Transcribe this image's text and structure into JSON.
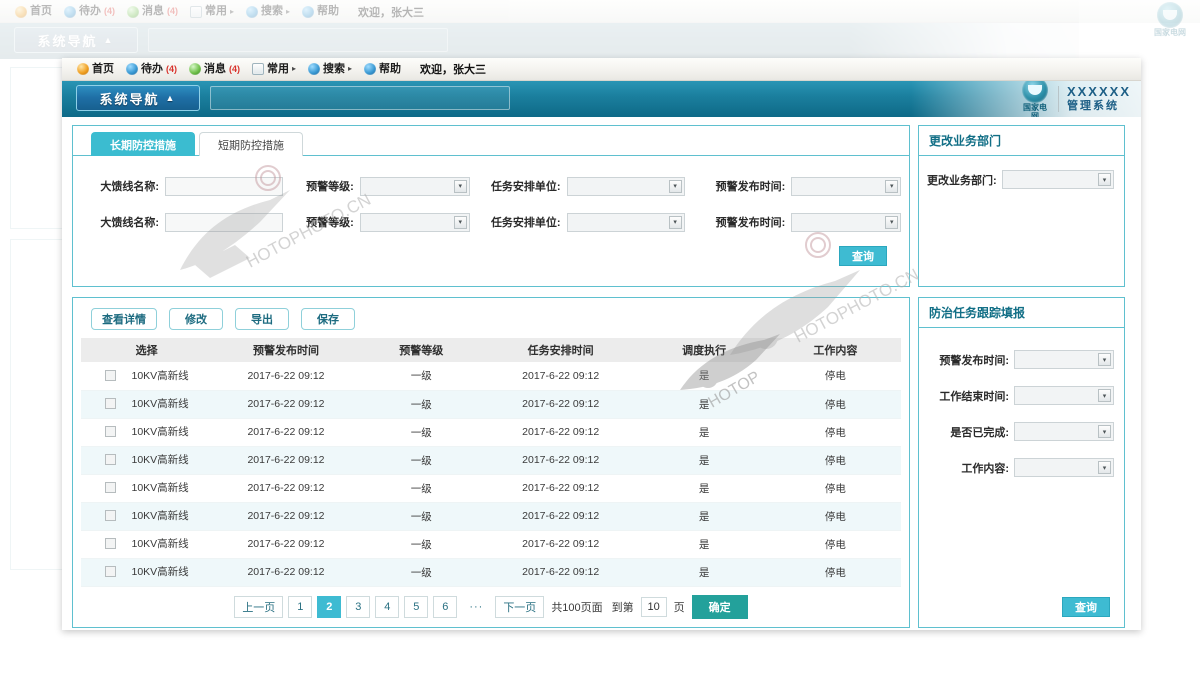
{
  "topbar": {
    "items": [
      {
        "label": "首页",
        "icon": "home-icon",
        "badge": "",
        "caret": false
      },
      {
        "label": "待办",
        "icon": "todo-icon",
        "badge": "(4)",
        "caret": false
      },
      {
        "label": "消息",
        "icon": "message-icon",
        "badge": "(4)",
        "caret": false
      },
      {
        "label": "常用",
        "icon": "common-icon",
        "badge": "",
        "caret": true
      },
      {
        "label": "搜索",
        "icon": "search-icon",
        "badge": "",
        "caret": true
      },
      {
        "label": "帮助",
        "icon": "help-icon",
        "badge": "",
        "caret": false
      }
    ],
    "welcome": "欢迎，张大三"
  },
  "nav": {
    "button_label": "系统导航",
    "button_caret": "▲"
  },
  "brand": {
    "logo_text": "国家电网",
    "title": "XXXXXX",
    "subtitle": "管理系统"
  },
  "search_panel": {
    "tabs": [
      {
        "label": "长期防控措施",
        "active": true
      },
      {
        "label": "短期防控措施",
        "active": false
      }
    ],
    "rows": [
      {
        "feeder_label": "大馈线名称:",
        "feeder_value": "",
        "level_label": "预警等级:",
        "level_value": "",
        "unit_label": "任务安排单位:",
        "unit_value": "",
        "time_label": "预警发布时间:",
        "time_value": ""
      },
      {
        "feeder_label": "大馈线名称:",
        "feeder_value": "",
        "level_label": "预警等级:",
        "level_value": "",
        "unit_label": "任务安排单位:",
        "unit_value": "",
        "time_label": "预警发布时间:",
        "time_value": ""
      }
    ],
    "query_button": "查询"
  },
  "table_panel": {
    "actions": [
      "查看详情",
      "修改",
      "导出",
      "保存"
    ],
    "columns": [
      "选择",
      "预警发布时间",
      "预警等级",
      "任务安排时间",
      "调度执行",
      "工作内容"
    ],
    "rows": [
      {
        "name": "10KV高新线",
        "publish_time": "2017-6-22 09:12",
        "level": "一级",
        "arrange_time": "2017-6-22 09:12",
        "dispatch": "是",
        "work": "停电"
      },
      {
        "name": "10KV高新线",
        "publish_time": "2017-6-22 09:12",
        "level": "一级",
        "arrange_time": "2017-6-22 09:12",
        "dispatch": "是",
        "work": "停电"
      },
      {
        "name": "10KV高新线",
        "publish_time": "2017-6-22 09:12",
        "level": "一级",
        "arrange_time": "2017-6-22 09:12",
        "dispatch": "是",
        "work": "停电"
      },
      {
        "name": "10KV高新线",
        "publish_time": "2017-6-22 09:12",
        "level": "一级",
        "arrange_time": "2017-6-22 09:12",
        "dispatch": "是",
        "work": "停电"
      },
      {
        "name": "10KV高新线",
        "publish_time": "2017-6-22 09:12",
        "level": "一级",
        "arrange_time": "2017-6-22 09:12",
        "dispatch": "是",
        "work": "停电"
      },
      {
        "name": "10KV高新线",
        "publish_time": "2017-6-22 09:12",
        "level": "一级",
        "arrange_time": "2017-6-22 09:12",
        "dispatch": "是",
        "work": "停电"
      },
      {
        "name": "10KV高新线",
        "publish_time": "2017-6-22 09:12",
        "level": "一级",
        "arrange_time": "2017-6-22 09:12",
        "dispatch": "是",
        "work": "停电"
      },
      {
        "name": "10KV高新线",
        "publish_time": "2017-6-22 09:12",
        "level": "一级",
        "arrange_time": "2017-6-22 09:12",
        "dispatch": "是",
        "work": "停电"
      }
    ]
  },
  "pagination": {
    "prev": "上一页",
    "pages": [
      "1",
      "2",
      "3",
      "4",
      "5",
      "6"
    ],
    "active_page": "2",
    "ellipsis": "···",
    "next": "下一页",
    "total_text": "共100页面",
    "goto_text": "到第",
    "goto_value": "10",
    "page_unit": "页",
    "ok_button": "确定"
  },
  "dept_panel": {
    "title": "更改业务部门",
    "field_label": "更改业务部门:",
    "field_value": ""
  },
  "track_panel": {
    "title": "防治任务跟踪填报",
    "fields": [
      {
        "label": "预警发布时间:",
        "value": ""
      },
      {
        "label": "工作结束时间:",
        "value": ""
      },
      {
        "label": "是否已完成:",
        "value": ""
      },
      {
        "label": "工作内容:",
        "value": ""
      }
    ],
    "query_button": "查询"
  },
  "colors": {
    "accent_teal": "#3ebbd2",
    "nav_band": "#1b7f9e",
    "panel_border": "#5fc0cf",
    "ok_green": "#23a19b",
    "badge_red": "#d8322b"
  }
}
